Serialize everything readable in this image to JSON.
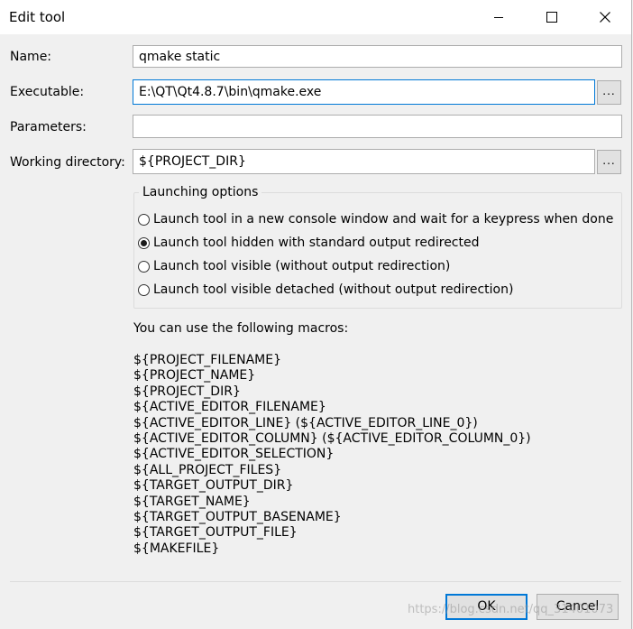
{
  "window": {
    "title": "Edit tool"
  },
  "form": {
    "name_label": "Name:",
    "name_value": "qmake static",
    "executable_label": "Executable:",
    "executable_value": "E:\\QT\\Qt4.8.7\\bin\\qmake.exe",
    "parameters_label": "Parameters:",
    "parameters_value": "",
    "workdir_label": "Working directory:",
    "workdir_value": "${PROJECT_DIR}",
    "browse_label": "..."
  },
  "launching": {
    "title": "Launching options",
    "options": [
      {
        "label": "Launch tool in a new console window and wait for a keypress when done",
        "checked": false
      },
      {
        "label": "Launch tool hidden with standard output redirected",
        "checked": true
      },
      {
        "label": "Launch tool visible (without output redirection)",
        "checked": false
      },
      {
        "label": "Launch tool visible detached (without output redirection)",
        "checked": false
      }
    ]
  },
  "macros": {
    "intro": "You can use the following macros:",
    "list": [
      "${PROJECT_FILENAME}",
      "${PROJECT_NAME}",
      "${PROJECT_DIR}",
      "${ACTIVE_EDITOR_FILENAME}",
      "${ACTIVE_EDITOR_LINE} (${ACTIVE_EDITOR_LINE_0})",
      "${ACTIVE_EDITOR_COLUMN} (${ACTIVE_EDITOR_COLUMN_0})",
      "${ACTIVE_EDITOR_SELECTION}",
      "${ALL_PROJECT_FILES}",
      "${TARGET_OUTPUT_DIR}",
      "${TARGET_NAME}",
      "${TARGET_OUTPUT_BASENAME}",
      "${TARGET_OUTPUT_FILE}",
      "${MAKEFILE}"
    ]
  },
  "buttons": {
    "ok": "OK",
    "cancel": "Cancel"
  },
  "watermark": "https://blog.csdn.net/qq_31401073",
  "colors": {
    "focus_accent": "#0078d7",
    "button_face": "#e1e1e1",
    "dialog_bg": "#f0f0f0"
  }
}
